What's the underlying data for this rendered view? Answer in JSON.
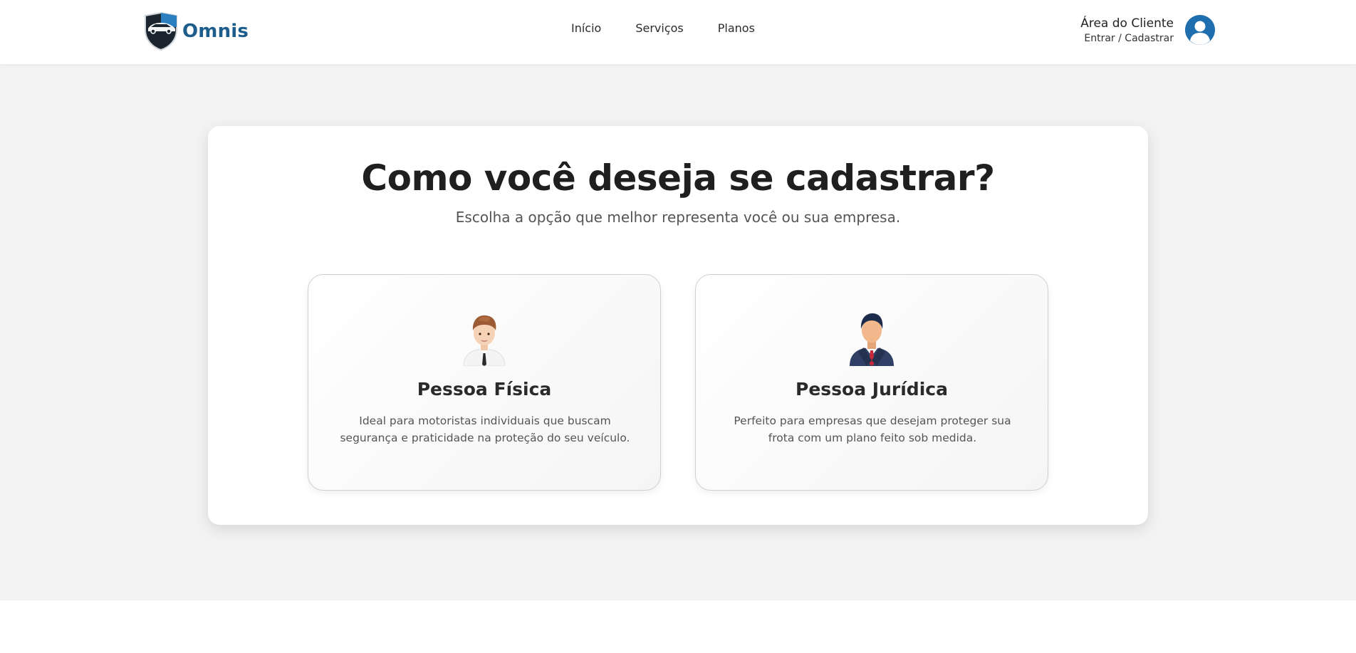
{
  "header": {
    "logo_text": "Omnis",
    "nav": [
      {
        "label": "Início"
      },
      {
        "label": "Serviços"
      },
      {
        "label": "Planos"
      }
    ],
    "client_area": {
      "title": "Área do Cliente",
      "subtitle": "Entrar / Cadastrar",
      "icon": "user-avatar-icon"
    }
  },
  "main": {
    "title": "Como você deseja se cadastrar?",
    "subtitle": "Escolha a opção que melhor representa você ou sua empresa.",
    "options": [
      {
        "title": "Pessoa Física",
        "description": "Ideal para motoristas individuais que buscam segurança e praticidade na proteção do seu veículo.",
        "icon": "person-casual-icon"
      },
      {
        "title": "Pessoa Jurídica",
        "description": "Perfeito para empresas que desejam proteger sua frota com um plano feito sob medida.",
        "icon": "businessman-icon"
      }
    ]
  },
  "colors": {
    "brand": "#1d5d8b",
    "accent": "#1f6fae",
    "page_bg": "#f3f3f3"
  }
}
